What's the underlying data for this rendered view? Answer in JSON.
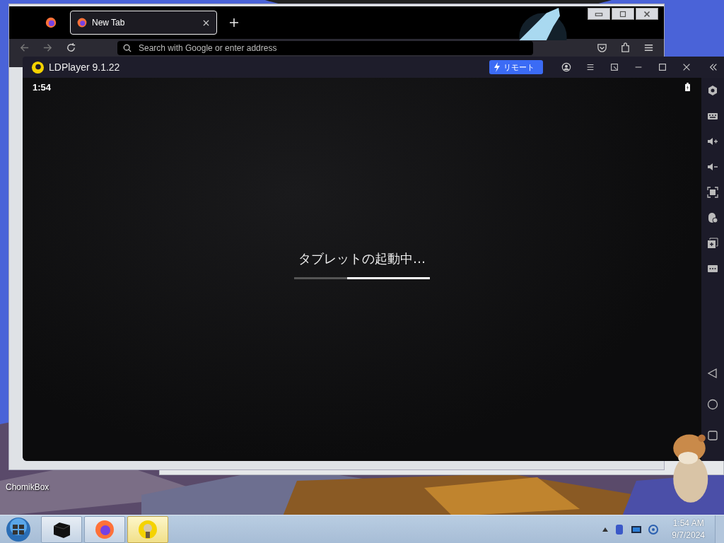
{
  "desktop": {
    "icons": [
      {
        "label": "ChomikBox"
      }
    ]
  },
  "browser": {
    "tabs": [
      {
        "label": "New Tab",
        "selected": true
      }
    ],
    "address_bar": {
      "placeholder": "Search with Google or enter address"
    }
  },
  "emulator": {
    "title": "LDPlayer 9.1.22",
    "remote_button": "リモート",
    "status_bar": {
      "time": "1:54"
    },
    "boot": {
      "message": "タブレットの起動中…",
      "level": 0.61
    }
  },
  "taskbar": {
    "items": [
      {
        "kind": "terminal",
        "selected": false
      },
      {
        "kind": "firefox",
        "selected": false
      },
      {
        "kind": "ldplayer",
        "selected": true
      }
    ],
    "clock": {
      "time": "1:54 AM",
      "date": "9/7/2024"
    }
  }
}
